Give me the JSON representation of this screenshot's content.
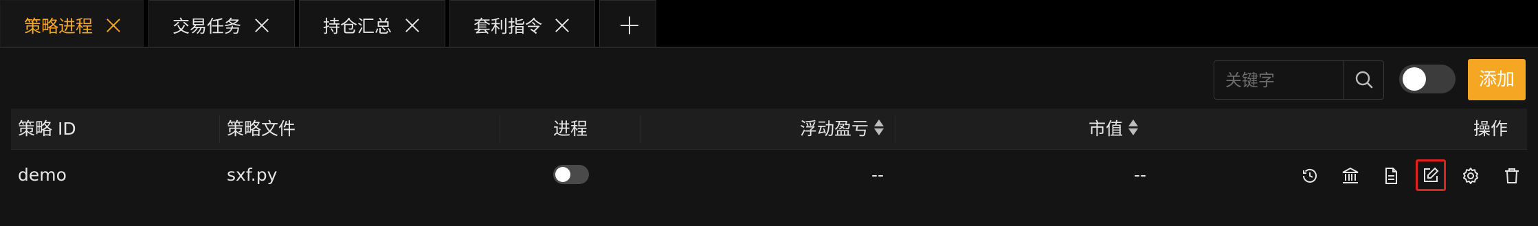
{
  "tabs": [
    {
      "label": "策略进程",
      "active": true
    },
    {
      "label": "交易任务",
      "active": false
    },
    {
      "label": "持仓汇总",
      "active": false
    },
    {
      "label": "套利指令",
      "active": false
    }
  ],
  "toolbar": {
    "search_placeholder": "关键字",
    "search_icon": "search-icon",
    "add_label": "添加"
  },
  "table": {
    "columns": [
      "策略 ID",
      "策略文件",
      "进程",
      "浮动盈亏",
      "市值",
      "操作"
    ],
    "rows": [
      {
        "id": "demo",
        "file": "sxf.py",
        "process_on": false,
        "pnl": "--",
        "market_value": "--"
      }
    ],
    "row_actions": [
      "history-icon",
      "bank-icon",
      "file-icon",
      "edit-icon",
      "settings-icon",
      "trash-icon"
    ]
  },
  "colors": {
    "accent": "#f5a623",
    "highlight": "#e0221c",
    "background": "#141414"
  }
}
